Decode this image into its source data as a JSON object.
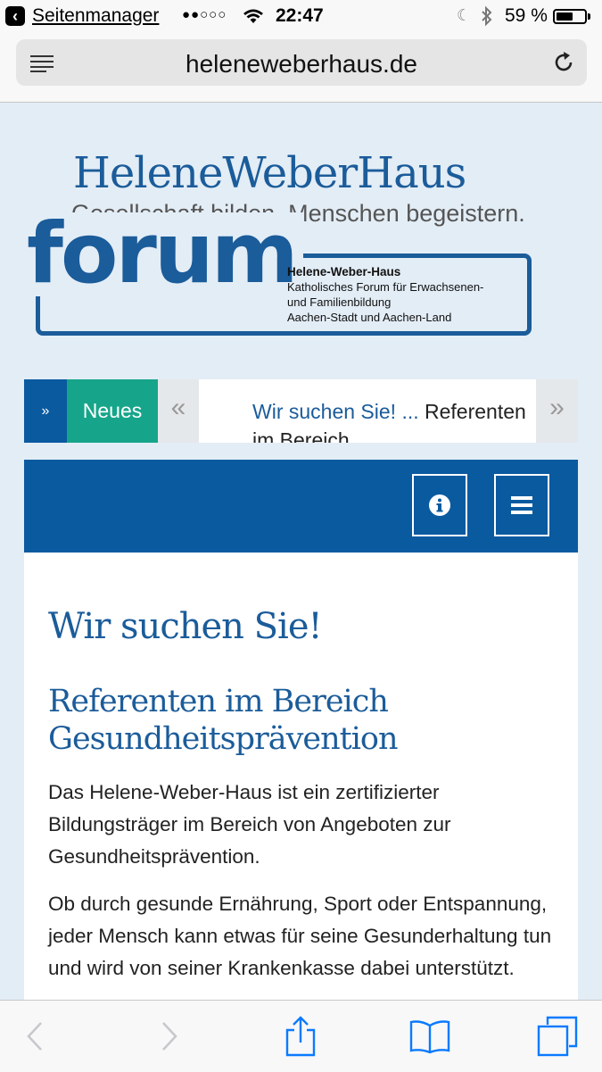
{
  "status_bar": {
    "back_app": "Seitenmanager",
    "signal": "●●○○○",
    "time": "22:47",
    "battery": "59 %",
    "battery_level": 0.59
  },
  "browser": {
    "url": "heleneweberhaus.de"
  },
  "logo": {
    "title": "HeleneWeberHaus",
    "subtitle": "Gesellschaft bilden. Menschen begeistern.",
    "forum_word": "forum",
    "forum_name": "Helene-Weber-Haus",
    "forum_line1": "Katholisches Forum für Erwachsenen-",
    "forum_line2": "und Familienbildung",
    "forum_line3": "Aachen-Stadt und Aachen-Land"
  },
  "ticker": {
    "arrow": "»",
    "label": "Neues",
    "prev": "«",
    "next": "»",
    "link_text": "Wir suchen Sie! ...",
    "text": " Referenten im Bereich"
  },
  "article": {
    "title": "Wir suchen Sie!",
    "subtitle": "Referenten im Bereich Gesundheitsprävention",
    "paragraph1": "Das Helene-Weber-Haus ist ein zertifizierter Bildungsträger im Bereich von Angeboten zur Gesundheitsprävention.",
    "paragraph2": "Ob durch gesunde Ernährung, Sport oder Entspannung, jeder Mensch kann etwas für seine Gesunderhaltung tun und wird von seiner Krankenkasse dabei unterstützt."
  },
  "colors": {
    "brand_blue": "#0a5aa0",
    "accent_green": "#16a58a",
    "background": "#e3edf6"
  }
}
